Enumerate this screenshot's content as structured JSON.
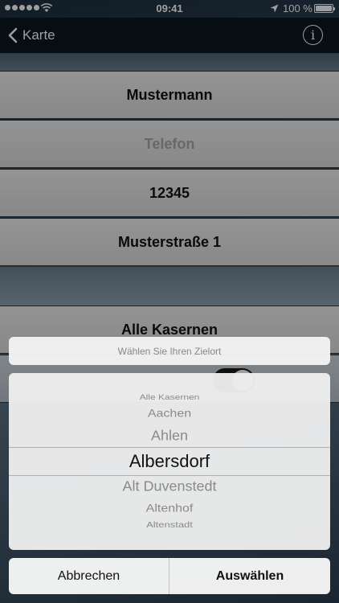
{
  "status_bar": {
    "time": "09:41",
    "battery_text": "100 %",
    "battery_level": 1.0,
    "icons": [
      "signal-dots-icon",
      "wifi-icon",
      "location-arrow-icon",
      "battery-icon"
    ]
  },
  "nav": {
    "back_label": "Karte",
    "info_glyph": "i"
  },
  "form": {
    "name_value": "Mustermann",
    "phone_placeholder": "Telefon",
    "zip_value": "12345",
    "street_value": "Musterstraße 1",
    "destination_value": "Alle Kasernen",
    "toggle_on": true
  },
  "picker": {
    "title": "Wählen Sie Ihren Zielort",
    "selected_index": 3,
    "options": [
      "Alle Kasernen",
      "Aachen",
      "Ahlen",
      "Albersdorf",
      "Alt Duvenstedt",
      "Altenhof",
      "Altenstadt"
    ]
  },
  "actions": {
    "cancel_label": "Abbrechen",
    "confirm_label": "Auswählen"
  },
  "colors": {
    "nav_background": "#0a1520",
    "field_background": "#e6e6e6",
    "placeholder_text": "#a8a8a8",
    "selected_text": "#111111"
  }
}
